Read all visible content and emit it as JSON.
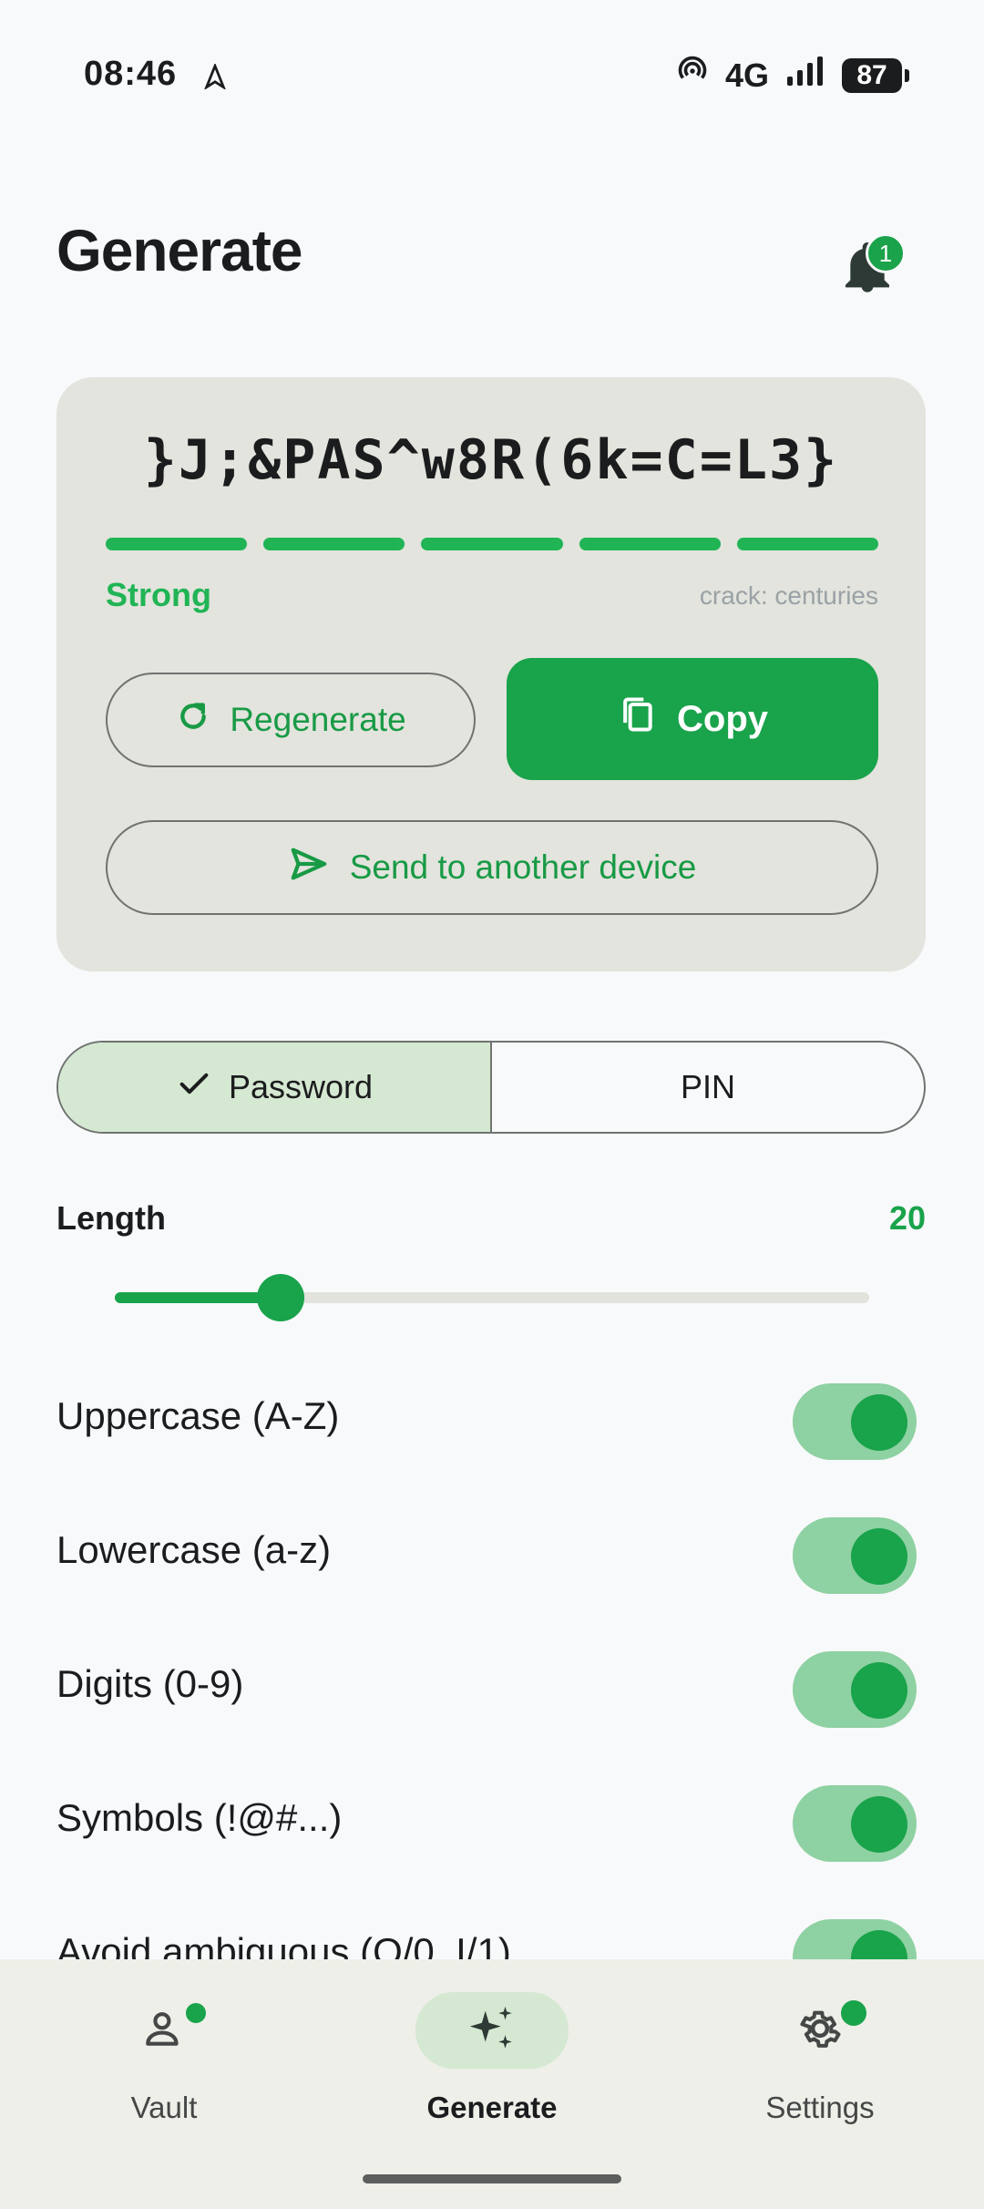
{
  "status_bar": {
    "time": "08:46",
    "network": "4G",
    "battery": "87"
  },
  "header": {
    "title": "Generate",
    "notification_count": "1"
  },
  "password_card": {
    "password": "}J;&PAS^w8R(6k=C=L3}",
    "strength_label": "Strong",
    "strength_segments_filled": 5,
    "crack_time": "crack: centuries",
    "regenerate_label": "Regenerate",
    "copy_label": "Copy",
    "send_label": "Send to another device"
  },
  "mode_toggle": {
    "password_label": "Password",
    "pin_label": "PIN",
    "selected": "Password"
  },
  "length": {
    "label": "Length",
    "value": "20",
    "fraction": 0.22
  },
  "options": [
    {
      "label": "Uppercase (A-Z)",
      "enabled": true
    },
    {
      "label": "Lowercase (a-z)",
      "enabled": true
    },
    {
      "label": "Digits (0-9)",
      "enabled": true
    },
    {
      "label": "Symbols (!@#...)",
      "enabled": true
    },
    {
      "label": "Avoid ambiguous (O/0, I/1)",
      "enabled": true
    }
  ],
  "bottom_nav": {
    "items": [
      {
        "label": "Vault",
        "icon": "person-icon"
      },
      {
        "label": "Generate",
        "icon": "sparkle-icon"
      },
      {
        "label": "Settings",
        "icon": "gear-icon"
      }
    ],
    "active": "Generate"
  },
  "colors": {
    "accent": "#19a34b",
    "card_bg": "#e2e4dd",
    "segment_selected": "#d5e8d1",
    "background": "#f8f9fb"
  }
}
